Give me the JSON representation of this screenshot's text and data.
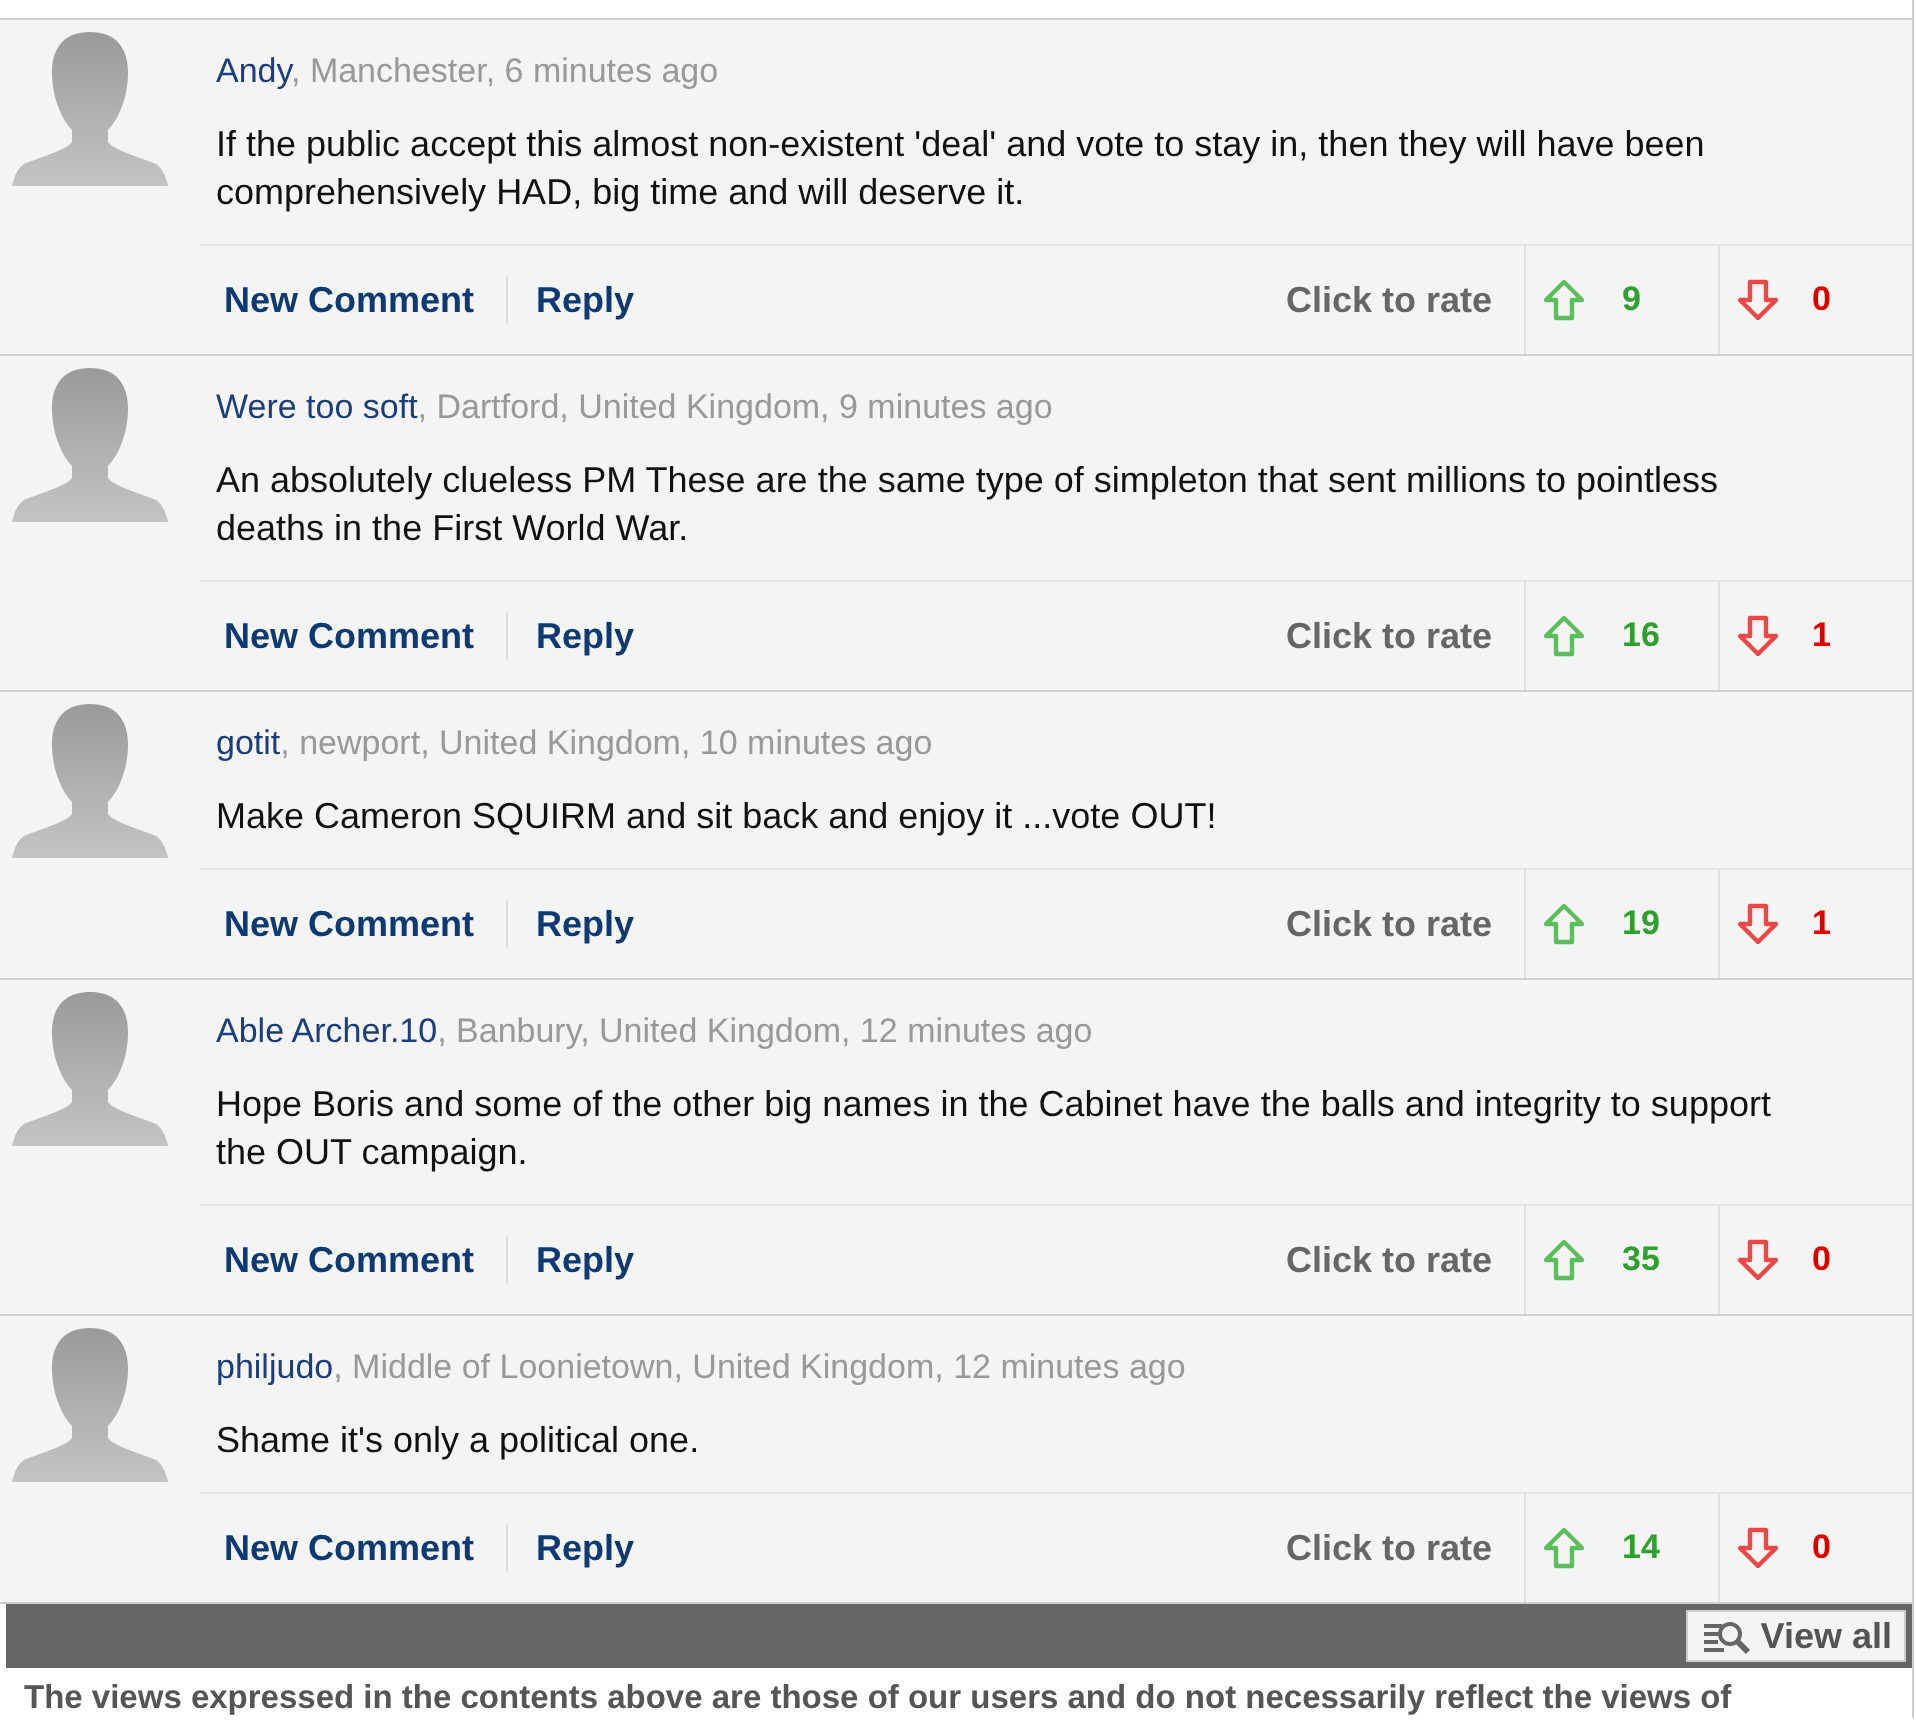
{
  "comments": [
    {
      "author": "Andy",
      "meta": ", Manchester, 6 minutes ago",
      "body": "If the public accept this almost non-existent 'deal' and vote to stay in, then they will have been comprehensively HAD, big time and will deserve it.",
      "new_comment": "New Comment",
      "reply": "Reply",
      "rate_label": "Click to rate",
      "up": "9",
      "down": "0"
    },
    {
      "author": "Were too soft",
      "meta": ", Dartford, United Kingdom, 9 minutes ago",
      "body": "An absolutely clueless PM These are the same type of simpleton that sent millions to pointless deaths in the First World War.",
      "new_comment": "New Comment",
      "reply": "Reply",
      "rate_label": "Click to rate",
      "up": "16",
      "down": "1"
    },
    {
      "author": "gotit",
      "meta": ", newport, United Kingdom, 10 minutes ago",
      "body": "Make Cameron SQUIRM and sit back and enjoy it ...vote OUT!",
      "new_comment": "New Comment",
      "reply": "Reply",
      "rate_label": "Click to rate",
      "up": "19",
      "down": "1"
    },
    {
      "author": "Able Archer.10",
      "meta": ", Banbury, United Kingdom, 12 minutes ago",
      "body": "Hope Boris and some of the other big names in the Cabinet have the balls and integrity to support the OUT campaign.",
      "new_comment": "New Comment",
      "reply": "Reply",
      "rate_label": "Click to rate",
      "up": "35",
      "down": "0"
    },
    {
      "author": "philjudo",
      "meta": ", Middle of Loonietown, United Kingdom, 12 minutes ago",
      "body": "Shame it's only a political one.",
      "new_comment": "New Comment",
      "reply": "Reply",
      "rate_label": "Click to rate",
      "up": "14",
      "down": "0"
    }
  ],
  "view_all": "View all",
  "disclaimer": "The views expressed in the contents above are those of our users and do not necessarily reflect the views of"
}
